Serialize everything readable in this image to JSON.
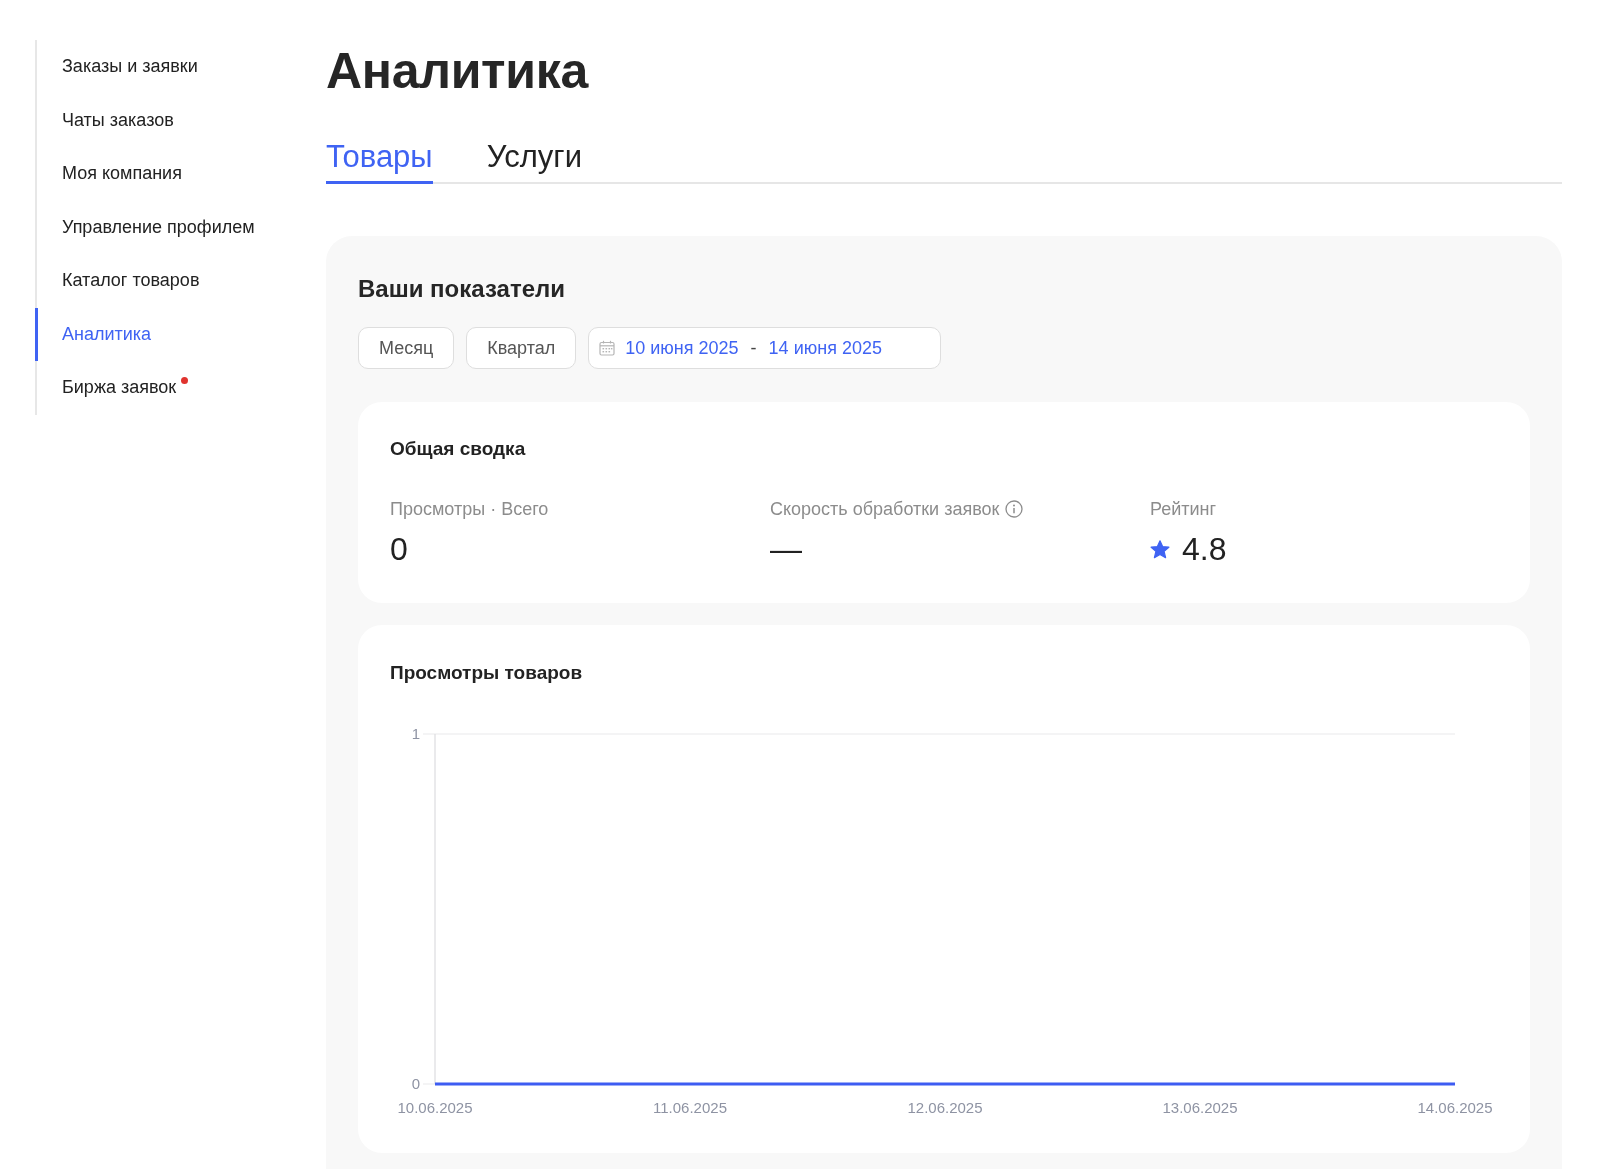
{
  "sidebar": {
    "items": [
      {
        "label": "Заказы и заявки",
        "selected": false,
        "has_dot": false
      },
      {
        "label": "Чаты заказов",
        "selected": false,
        "has_dot": false
      },
      {
        "label": "Моя компания",
        "selected": false,
        "has_dot": false
      },
      {
        "label": "Управление профилем",
        "selected": false,
        "has_dot": false
      },
      {
        "label": "Каталог товаров",
        "selected": false,
        "has_dot": false
      },
      {
        "label": "Аналитика",
        "selected": true,
        "has_dot": false
      },
      {
        "label": "Биржа заявок",
        "selected": false,
        "has_dot": true
      }
    ]
  },
  "page_title": "Аналитика",
  "tabs": [
    {
      "label": "Товары",
      "selected": true
    },
    {
      "label": "Услуги",
      "selected": false
    }
  ],
  "metrics_panel": {
    "title": "Ваши показатели",
    "period_buttons": [
      {
        "label": "Месяц",
        "selected": false
      },
      {
        "label": "Квартал",
        "selected": false
      }
    ],
    "date_range": {
      "from": "10 июня 2025",
      "separator": "-",
      "to": "14 июня 2025"
    },
    "summary": {
      "title": "Общая сводка",
      "metrics": [
        {
          "kind": "plain",
          "label": "Просмотры · Всего",
          "value": "0"
        },
        {
          "kind": "info",
          "label": "Скорость обработки заявок",
          "value": "—"
        },
        {
          "kind": "rating",
          "label": "Рейтинг",
          "value": "4.8"
        }
      ]
    },
    "views_chart": {
      "title": "Просмотры товаров",
      "chart_data": {
        "type": "line",
        "categories": [
          "10.06.2025",
          "11.06.2025",
          "12.06.2025",
          "13.06.2025",
          "14.06.2025"
        ],
        "series": [
          {
            "color": "#3d5cf2",
            "values": [
              0,
              0,
              0,
              0,
              0
            ]
          }
        ],
        "ylim": [
          0,
          1
        ],
        "yticks": [
          0,
          1
        ]
      }
    }
  }
}
